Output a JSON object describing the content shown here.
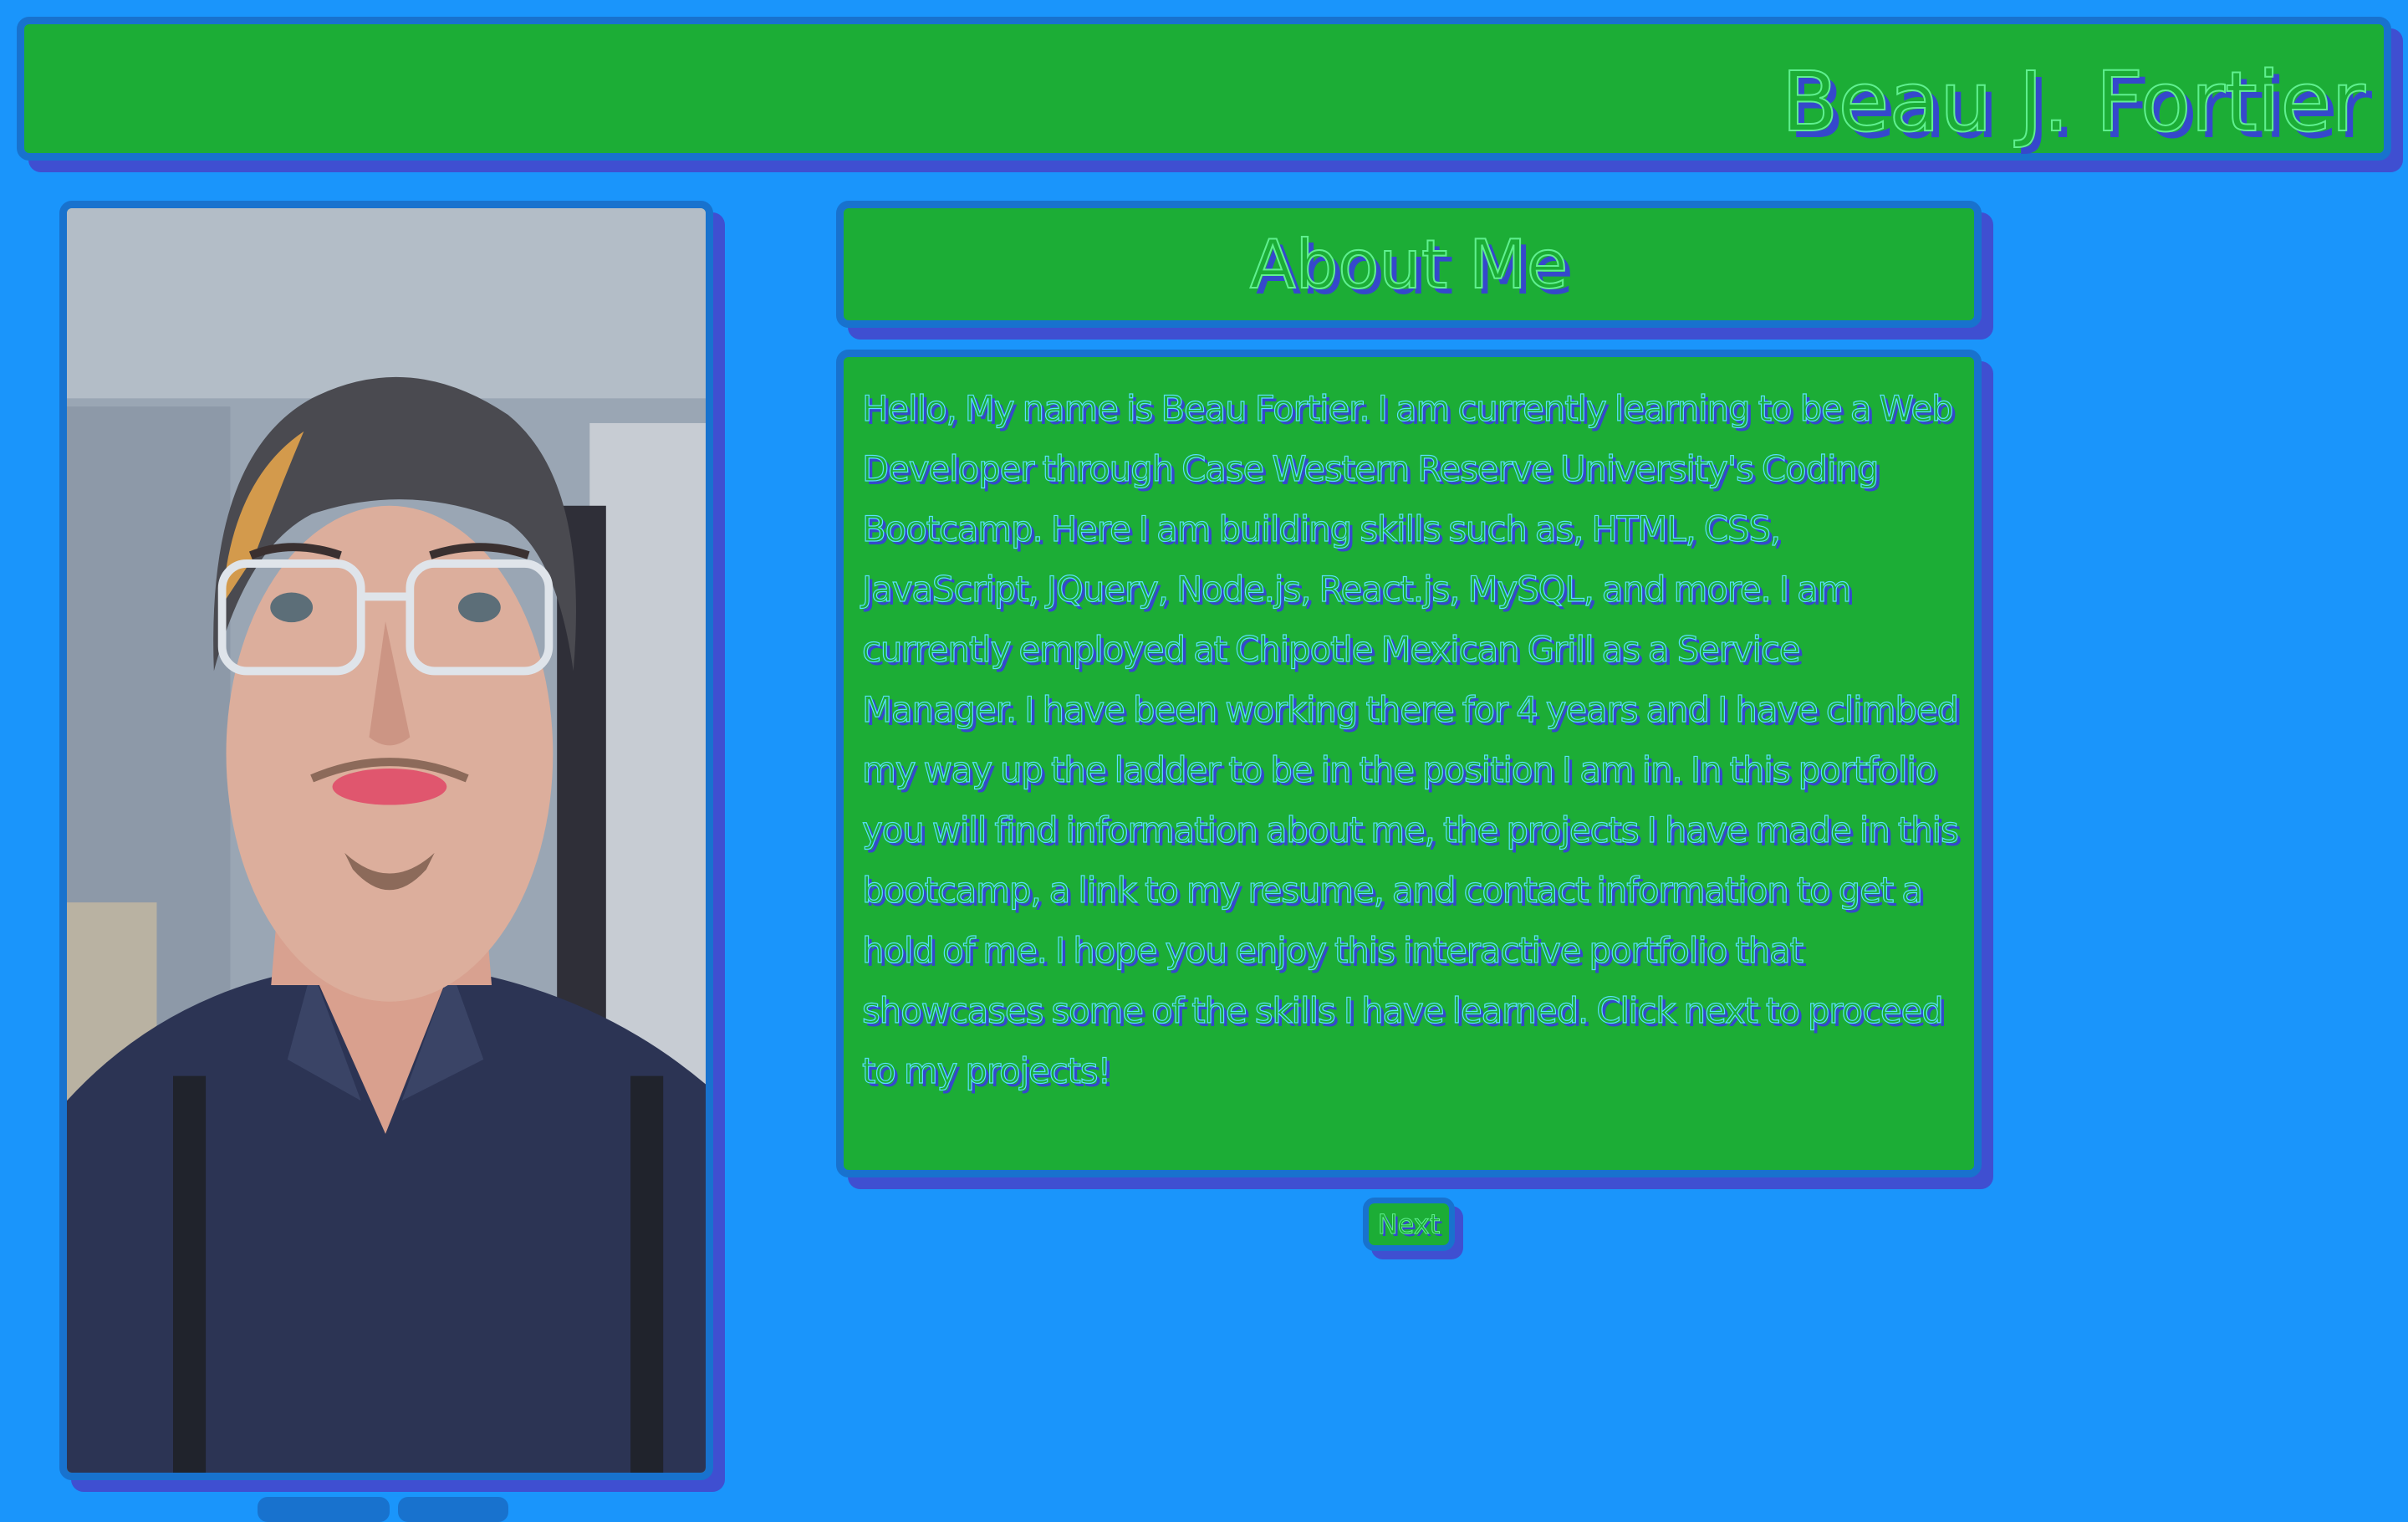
{
  "header": {
    "title": "Beau J. Fortier"
  },
  "profile_photo": {
    "description_icon": "portrait-photo"
  },
  "about": {
    "title": "About Me",
    "text": "Hello, My name is Beau Fortier. I am currently learning to be a Web Developer through Case Western Reserve University's Coding Bootcamp. Here I am building skills such as, HTML, CSS, JavaScript, JQuery, Node.js, React.js, MySQL, and more. I am currently employed at Chipotle Mexican Grill as a Service Manager. I have been working there for 4 years and I have climbed my way up the ladder to be in the position I am in. In this portfolio you will find information about me, the projects I have made in this bootcamp, a link to my resume, and contact information to get a hold of me. I hope you enjoy this interactive portfolio that showcases some of the skills I have learned. Click next to proceed to my projects!",
    "next_label": "Next"
  },
  "colors": {
    "background": "#1a95fb",
    "panel": "#1cad36",
    "border": "#1872ce",
    "shadow": "#3f4fd1",
    "text_outline": "#5ff08f"
  }
}
